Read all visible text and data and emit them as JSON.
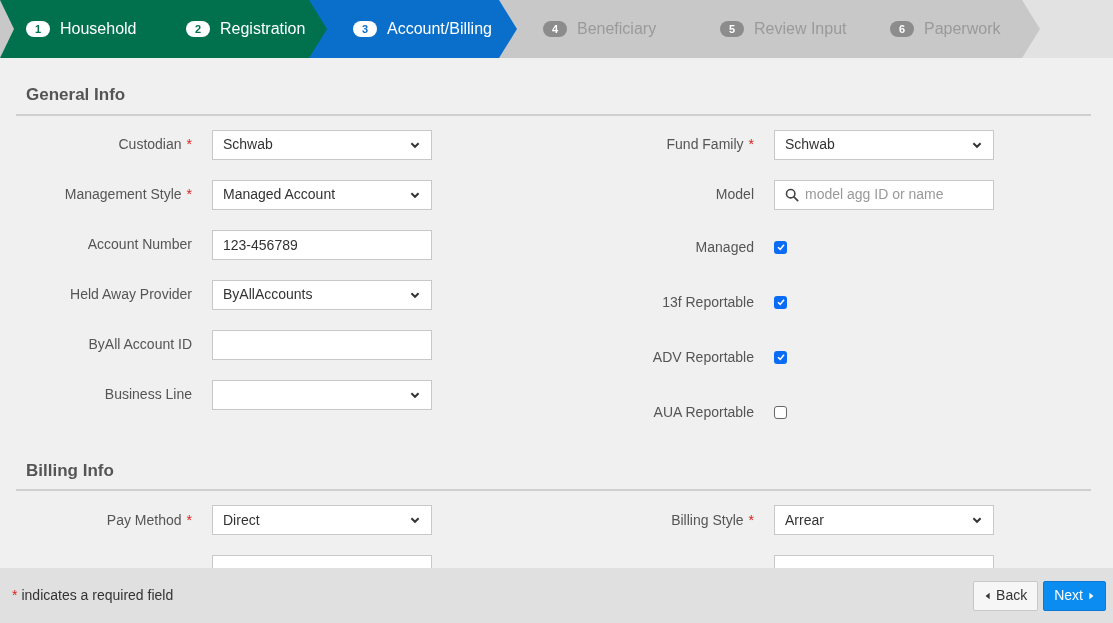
{
  "steps": [
    {
      "number": "1",
      "label": "Household",
      "completed": true,
      "selected": false
    },
    {
      "number": "2",
      "label": "Registration",
      "completed": true,
      "selected": false
    },
    {
      "number": "3",
      "label": "Account/Billing",
      "completed": false,
      "selected": true
    },
    {
      "number": "4",
      "label": "Beneficiary",
      "completed": false,
      "selected": false
    },
    {
      "number": "5",
      "label": "Review Input",
      "completed": false,
      "selected": false
    },
    {
      "number": "6",
      "label": "Paperwork",
      "completed": false,
      "selected": false
    }
  ],
  "sections": [
    {
      "title": "General Info",
      "left": [
        {
          "label": "Custodian",
          "required": true,
          "kind": "select",
          "value": "Schwab"
        },
        {
          "label": "Management Style",
          "required": true,
          "kind": "select",
          "value": "Managed Account"
        },
        {
          "label": "Account Number",
          "required": false,
          "kind": "text",
          "value": "123-456789"
        },
        {
          "label": "Held Away Provider",
          "required": false,
          "kind": "select",
          "value": "ByAllAccounts"
        },
        {
          "label": "ByAll Account ID",
          "required": false,
          "kind": "text"
        },
        {
          "label": "Business Line",
          "required": false,
          "kind": "select"
        }
      ],
      "right": [
        {
          "label": "Fund Family",
          "required": true,
          "kind": "select",
          "value": "Schwab"
        },
        {
          "label": "Model",
          "required": false,
          "kind": "search",
          "placeholder": "model agg ID or name"
        },
        {
          "label": "Managed",
          "required": false,
          "kind": "checkbox",
          "checked": true
        },
        {
          "label": "13f Reportable",
          "required": false,
          "kind": "checkbox",
          "checked": true
        },
        {
          "label": "ADV Reportable",
          "required": false,
          "kind": "checkbox",
          "checked": true
        },
        {
          "label": "AUA Reportable",
          "required": false,
          "kind": "checkbox",
          "checked": false
        }
      ]
    },
    {
      "title": "Billing Info",
      "left": [
        {
          "label": "Pay Method",
          "required": true,
          "kind": "select",
          "value": "Direct"
        },
        {
          "required": false,
          "kind": "text"
        }
      ],
      "right": [
        {
          "label": "Billing Style",
          "required": true,
          "kind": "select",
          "value": "Arrear"
        },
        {
          "required": false,
          "kind": "text"
        }
      ]
    }
  ],
  "footer": {
    "required_mark": "*",
    "note": "indicates a required field",
    "back": "Back",
    "next": "Next"
  }
}
